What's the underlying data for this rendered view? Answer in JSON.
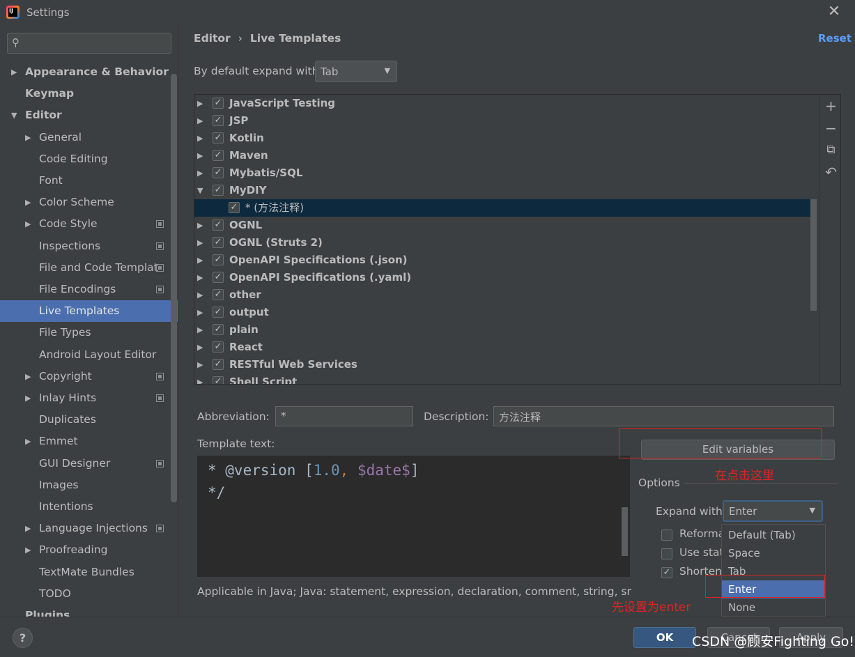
{
  "window": {
    "title": "Settings"
  },
  "sidebar": {
    "search_placeholder": "",
    "items": [
      {
        "label": "Appearance & Behavior",
        "level": 0,
        "arrow": "▶",
        "bold": true
      },
      {
        "label": "Keymap",
        "level": 0,
        "arrow": "",
        "bold": true
      },
      {
        "label": "Editor",
        "level": 0,
        "arrow": "▼",
        "bold": true
      },
      {
        "label": "General",
        "level": 1,
        "arrow": "▶"
      },
      {
        "label": "Code Editing",
        "level": 1,
        "arrow": ""
      },
      {
        "label": "Font",
        "level": 1,
        "arrow": ""
      },
      {
        "label": "Color Scheme",
        "level": 1,
        "arrow": "▶"
      },
      {
        "label": "Code Style",
        "level": 1,
        "arrow": "▶",
        "copy_icon": true
      },
      {
        "label": "Inspections",
        "level": 1,
        "arrow": "",
        "copy_icon": true
      },
      {
        "label": "File and Code Templat",
        "level": 1,
        "arrow": "",
        "copy_icon": true
      },
      {
        "label": "File Encodings",
        "level": 1,
        "arrow": "",
        "copy_icon": true
      },
      {
        "label": "Live Templates",
        "level": 1,
        "arrow": "",
        "selected": true
      },
      {
        "label": "File Types",
        "level": 1,
        "arrow": ""
      },
      {
        "label": "Android Layout Editor",
        "level": 1,
        "arrow": ""
      },
      {
        "label": "Copyright",
        "level": 1,
        "arrow": "▶",
        "copy_icon": true
      },
      {
        "label": "Inlay Hints",
        "level": 1,
        "arrow": "▶",
        "copy_icon": true
      },
      {
        "label": "Duplicates",
        "level": 1,
        "arrow": ""
      },
      {
        "label": "Emmet",
        "level": 1,
        "arrow": "▶"
      },
      {
        "label": "GUI Designer",
        "level": 1,
        "arrow": "",
        "copy_icon": true
      },
      {
        "label": "Images",
        "level": 1,
        "arrow": ""
      },
      {
        "label": "Intentions",
        "level": 1,
        "arrow": ""
      },
      {
        "label": "Language Injections",
        "level": 1,
        "arrow": "▶",
        "copy_icon": true
      },
      {
        "label": "Proofreading",
        "level": 1,
        "arrow": "▶"
      },
      {
        "label": "TextMate Bundles",
        "level": 1,
        "arrow": ""
      },
      {
        "label": "TODO",
        "level": 1,
        "arrow": ""
      },
      {
        "label": "Plugins",
        "level": 0,
        "arrow": "",
        "bold": true
      }
    ]
  },
  "header": {
    "breadcrumb_parent": "Editor",
    "breadcrumb_sep": "›",
    "breadcrumb_current": "Live Templates",
    "reset_label": "Reset",
    "default_expand_label": "By default expand with",
    "default_expand_value": "Tab"
  },
  "tree": {
    "rows": [
      {
        "label": "JavaScript Testing",
        "type": "group",
        "arrow": "▶",
        "checked": true
      },
      {
        "label": "JSP",
        "type": "group",
        "arrow": "▶",
        "checked": true
      },
      {
        "label": "Kotlin",
        "type": "group",
        "arrow": "▶",
        "checked": true
      },
      {
        "label": "Maven",
        "type": "group",
        "arrow": "▶",
        "checked": true
      },
      {
        "label": "Mybatis/SQL",
        "type": "group",
        "arrow": "▶",
        "checked": true
      },
      {
        "label": "MyDIY",
        "type": "group",
        "arrow": "▼",
        "checked": true
      },
      {
        "label": "* (方法注释)",
        "type": "item",
        "arrow": "",
        "checked": true,
        "selected": true
      },
      {
        "label": "OGNL",
        "type": "group",
        "arrow": "▶",
        "checked": true
      },
      {
        "label": "OGNL (Struts 2)",
        "type": "group",
        "arrow": "▶",
        "checked": true
      },
      {
        "label": "OpenAPI Specifications (.json)",
        "type": "group",
        "arrow": "▶",
        "checked": true
      },
      {
        "label": "OpenAPI Specifications (.yaml)",
        "type": "group",
        "arrow": "▶",
        "checked": true
      },
      {
        "label": "other",
        "type": "group",
        "arrow": "▶",
        "checked": true
      },
      {
        "label": "output",
        "type": "group",
        "arrow": "▶",
        "checked": true
      },
      {
        "label": "plain",
        "type": "group",
        "arrow": "▶",
        "checked": true
      },
      {
        "label": "React",
        "type": "group",
        "arrow": "▶",
        "checked": true
      },
      {
        "label": "RESTful Web Services",
        "type": "group",
        "arrow": "▶",
        "checked": true
      },
      {
        "label": "Shell Script",
        "type": "group",
        "arrow": "▶",
        "checked": true
      }
    ],
    "toolbar": {
      "add": "+",
      "remove": "−",
      "copy": "⧉",
      "restore": "↶"
    }
  },
  "details": {
    "abbreviation_label": "Abbreviation:",
    "abbreviation_value": "*",
    "description_label": "Description:",
    "description_value": "方法注释",
    "template_text_label": "Template text:",
    "template_lines": [
      {
        "segments": [
          {
            "t": "* @version [",
            "c": ""
          },
          {
            "t": "1.0",
            "c": "num"
          },
          {
            "t": ", ",
            "c": "cm"
          },
          {
            "t": "$date$",
            "c": "var"
          },
          {
            "t": "]",
            "c": ""
          }
        ]
      },
      {
        "segments": [
          {
            "t": "*/",
            "c": ""
          }
        ]
      }
    ],
    "edit_variables_label": "Edit variables",
    "options_label": "Options",
    "expand_with_label": "Expand with",
    "expand_with_value": "Enter",
    "option_rows": [
      {
        "label": "Reforma",
        "checked": false
      },
      {
        "label": "Use stat",
        "checked": false
      },
      {
        "label": "Shorten",
        "checked": true
      }
    ],
    "dropdown_options": [
      "Default (Tab)",
      "Space",
      "Tab",
      "Enter",
      "None"
    ],
    "dropdown_active": "Enter",
    "applicable_text": "Applicable in Java; Java: statement, expression, declaration, comment, string, smart typ"
  },
  "annotations": {
    "click_here": "在点击这里",
    "set_enter": "先设置为enter",
    "color": "#e02323"
  },
  "footer": {
    "help": "?",
    "ok": "OK",
    "cancel": "Cancel",
    "apply": "Apply",
    "watermark": "CSDN @顾安Fighting Go!"
  },
  "colors": {
    "background": "#3c3f41",
    "selection": "#4b6eaf",
    "tree_selection": "#0d293e",
    "link": "#589df6"
  }
}
